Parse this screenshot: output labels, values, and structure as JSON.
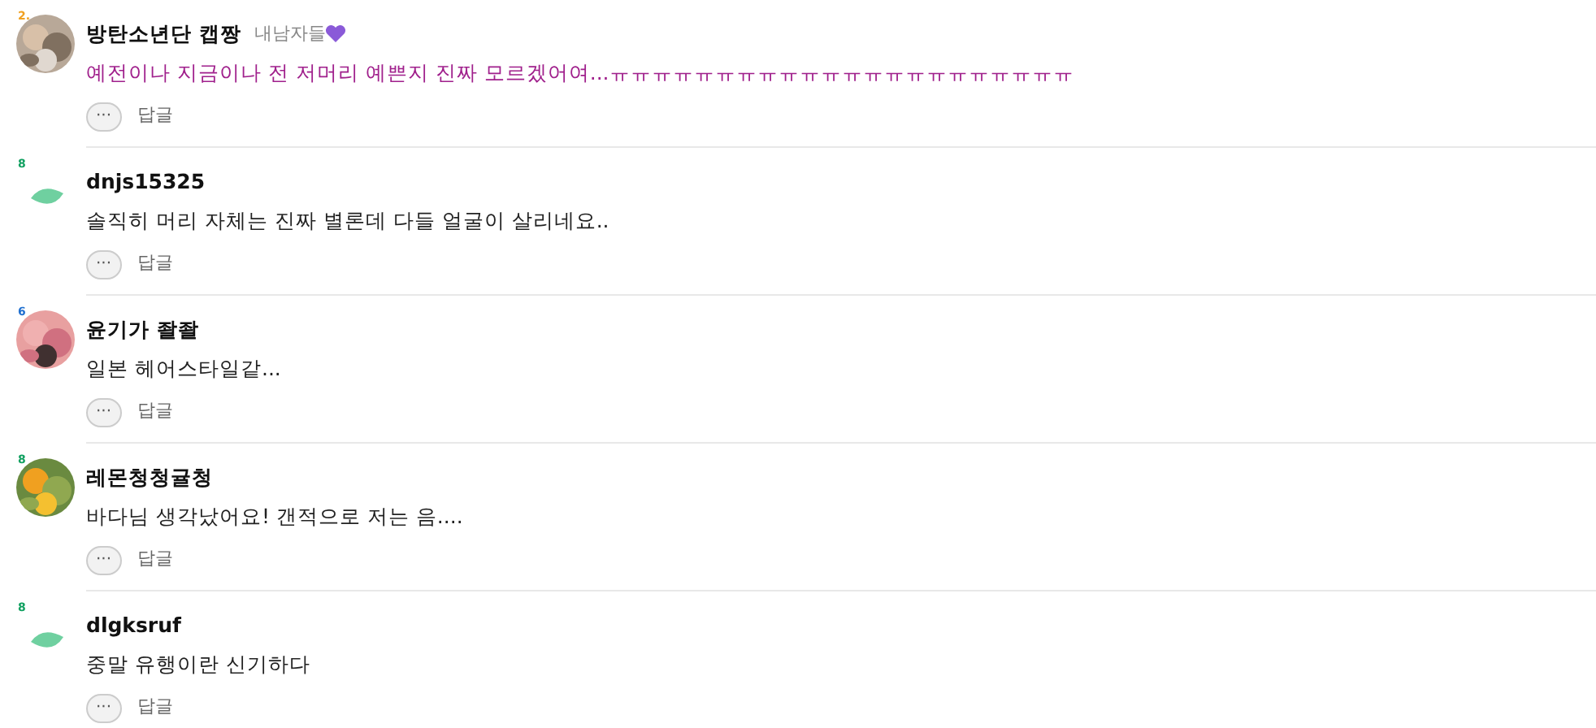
{
  "comments": [
    {
      "author": "방탄소년단 캡짱",
      "tag": "내남자들",
      "level_badge": "2.",
      "color": "#f0a020",
      "kind": "picture",
      "highlighted": true,
      "text": "예전이나 지금이나 전 저머리 예쁜지 진짜 모르겠어여...ㅠㅠㅠㅠㅠㅠㅠㅠㅠㅠㅠㅠㅠㅠㅠㅠㅠㅠㅠㅠㅠㅠ",
      "more": "···",
      "reply": "답글"
    },
    {
      "author": "dnjs15325",
      "level_badge": "8",
      "color": "#10a060",
      "kind": "leaf",
      "highlighted": false,
      "text": "솔직히 머리 자체는 진짜 별론데 다들 얼굴이 살리네요..",
      "more": "···",
      "reply": "답글"
    },
    {
      "author": "윤기가 좔좔",
      "level_badge": "6",
      "color": "#2070d0",
      "kind": "picture",
      "highlighted": false,
      "text": "일본 헤어스타일같...",
      "more": "···",
      "reply": "답글"
    },
    {
      "author": "레몬청청귤청",
      "level_badge": "8",
      "color": "#10a060",
      "kind": "picture",
      "highlighted": false,
      "text": "바다님 생각났어요! 갠적으로 저는 음....",
      "more": "···",
      "reply": "답글"
    },
    {
      "author": "dlgksruf",
      "level_badge": "8",
      "color": "#10a060",
      "kind": "leaf",
      "highlighted": false,
      "text": "중말 유행이란 신기하다",
      "more": "···",
      "reply": "답글"
    }
  ]
}
